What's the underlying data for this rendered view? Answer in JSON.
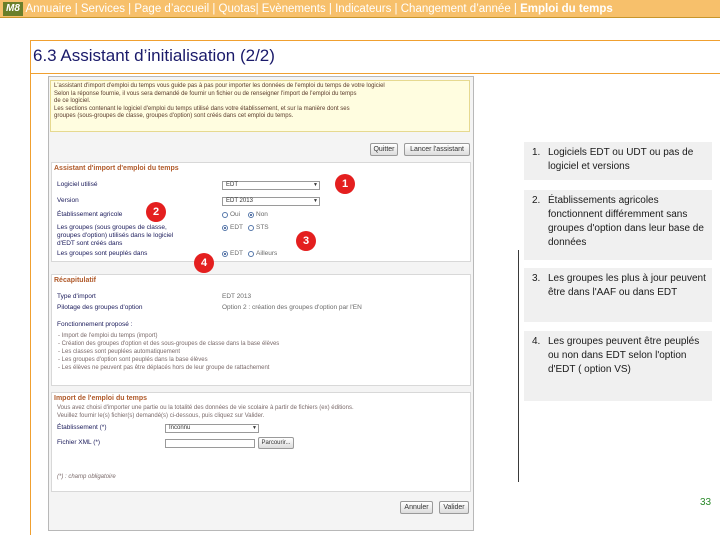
{
  "topnav": {
    "logo": "M8",
    "items": [
      "Annuaire |",
      "Services | Page d’accueil | Quotas| Evènements | Indicateurs |",
      "Changement d’année |",
      "Emploi du temps"
    ]
  },
  "slide": {
    "title": "6.3 Assistant d’initialisation (2/2)",
    "page_number": "33"
  },
  "screenshot": {
    "intro": [
      "L'assistant d'import d'emploi du temps vous guide pas à pas pour importer les données de l'emploi du temps de votre logiciel",
      "Selon la réponse fournie, il vous sera demandé de fournir un fichier ou de renseigner l'import de l'emploi du temps",
      "de ce logiciel.",
      "Les sections contenant le logiciel d'emploi du temps utilisé dans votre établissement, et sur la manière dont ses",
      "groupes (sous-groupes de classe, groupes d'option) sont créés dans cet emploi du temps."
    ],
    "btn_quit": "Quitter",
    "btn_launch": "Lancer l'assistant",
    "import_section": {
      "title": "Assistant d'import d'emploi du temps",
      "software_label": "Logiciel utilisé",
      "software_value": "EDT",
      "version_label": "Version",
      "version_value": "EDT 2013",
      "agri_label": "Établissement agricole",
      "agri_opt1": "Oui",
      "agri_opt2": "Non",
      "groups_label_1": "Les groupes (sous groupes de classe,",
      "groups_label_2": "groupes d'option) utilisés dans le logiciel",
      "groups_label_3": "d'EDT sont créés dans",
      "groups_opt1": "EDT",
      "groups_opt2": "STS",
      "peopled_label": "Les groupes sont peuplés dans",
      "peopled_opt1": "EDT",
      "peopled_opt2": "Ailleurs"
    },
    "summary_section": {
      "title": "Récapitulatif",
      "import_type_label": "Type d'import",
      "import_type_value": "EDT 2013",
      "pilot_label": "Pilotage des groupes d'option",
      "pilot_value": "Option 2 : création des groupes d'option par l'EN",
      "features_label": "Fonctionnement proposé :",
      "bullets": [
        "- Import de l'emploi du temps (import)",
        "- Création des groupes d'option et des sous-groupes de classe dans la base élèves",
        "- Les classes sont peuplées automatiquement",
        "- Les groupes d'option sont peuplés dans la base élèves",
        "- Les élèves ne peuvent pas être déplacés hors de leur groupe de rattachement"
      ]
    },
    "edt_section": {
      "title": "Import de l'emploi du temps",
      "desc_1": "Vous avez choisi d'importer une partie ou la totalité des données de vie scolaire à partir de fichiers (ex) éditions.",
      "desc_2": "Veuillez fournir le(s) fichier(s) demandé(s) ci-dessous, puis cliquez sur Valider.",
      "etab_label": "Établissement (*)",
      "etab_value": "Inconnu",
      "file_label": "Fichier XML (*)",
      "browse": "Parcourir...",
      "footnote": "(*) : champ obligatoire"
    },
    "btn_cancel": "Annuler",
    "btn_validate": "Valider"
  },
  "markers": [
    "1",
    "2",
    "3",
    "4"
  ],
  "notes": [
    {
      "num": "1.",
      "text": "Logiciels EDT ou UDT ou pas de logiciel  et versions"
    },
    {
      "num": "2.",
      "text": "Établissements agricoles fonctionnent différemment sans groupes d'option dans leur base de données"
    },
    {
      "num": "3.",
      "text": "Les groupes les plus à jour peuvent être dans l'AAF ou dans EDT"
    },
    {
      "num": "4.",
      "text": "Les groupes peuvent être peuplés ou non dans EDT selon l'option d'EDT ( option VS)"
    }
  ],
  "colors": {
    "nav_bg": "#f7c06b",
    "accent_orange": "#f0a030",
    "title_navy": "#1a1a6a",
    "marker_red": "#e41f1f",
    "note_bg": "#f0f0f0",
    "page_num_green": "#2a8a2a"
  }
}
